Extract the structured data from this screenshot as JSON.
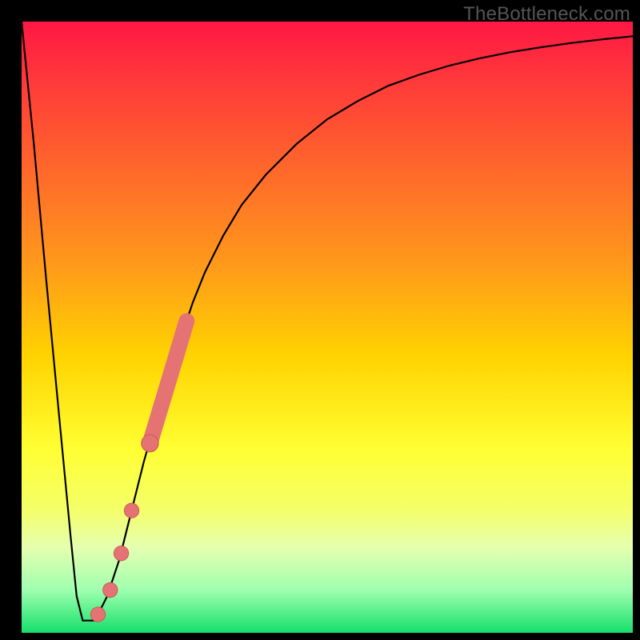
{
  "watermark": "TheBottleneck.com",
  "colors": {
    "frame_bg": "#000000",
    "curve": "#000000",
    "marker_fill": "#e57373",
    "marker_stroke": "#c85a5a",
    "gradient_stops": [
      {
        "offset": 0.0,
        "color": "#ff1744"
      },
      {
        "offset": 0.1,
        "color": "#ff3a3a"
      },
      {
        "offset": 0.25,
        "color": "#ff6a2a"
      },
      {
        "offset": 0.4,
        "color": "#ff9a1a"
      },
      {
        "offset": 0.55,
        "color": "#ffd400"
      },
      {
        "offset": 0.7,
        "color": "#ffff33"
      },
      {
        "offset": 0.8,
        "color": "#f4ff6a"
      },
      {
        "offset": 0.86,
        "color": "#e6ffb0"
      },
      {
        "offset": 0.93,
        "color": "#9fffaf"
      },
      {
        "offset": 1.0,
        "color": "#16e06a"
      }
    ]
  },
  "chart_data": {
    "type": "line",
    "title": "",
    "xlabel": "",
    "ylabel": "",
    "xlim": [
      0,
      100
    ],
    "ylim": [
      0,
      100
    ],
    "series": [
      {
        "name": "bottleneck-curve",
        "x": [
          0,
          2,
          4,
          6,
          8,
          9,
          10,
          11,
          12,
          14,
          16,
          18,
          20,
          22,
          24,
          26,
          28,
          30,
          33,
          36,
          40,
          45,
          50,
          55,
          60,
          65,
          70,
          75,
          80,
          85,
          90,
          95,
          100
        ],
        "y": [
          100,
          80,
          58,
          37,
          16,
          6,
          2,
          2,
          2,
          6,
          12,
          20,
          28,
          35,
          42,
          48,
          54,
          59,
          65,
          70,
          75,
          80,
          84,
          87,
          89.5,
          91.3,
          92.8,
          94,
          95,
          95.8,
          96.5,
          97.1,
          97.6
        ]
      }
    ],
    "markers": {
      "name": "highlight-points",
      "type": "scatter",
      "points": [
        {
          "x": 12.5,
          "y": 3,
          "r": 1.2
        },
        {
          "x": 14.5,
          "y": 7,
          "r": 1.2
        },
        {
          "x": 16.3,
          "y": 13,
          "r": 1.2
        },
        {
          "x": 18.0,
          "y": 20,
          "r": 1.2
        },
        {
          "x": 21.0,
          "y": 31,
          "r": 1.4
        }
      ],
      "bar_segment": {
        "x1": 21.0,
        "y1": 31,
        "x2": 27.0,
        "y2": 51,
        "width": 2.6
      }
    }
  }
}
